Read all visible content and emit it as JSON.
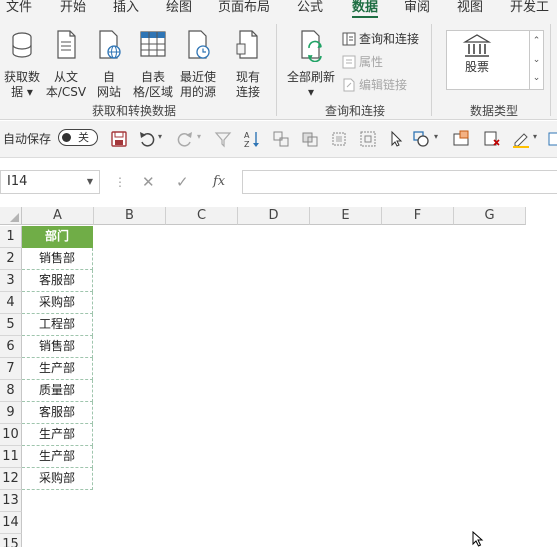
{
  "menu": {
    "tabs": [
      "文件",
      "开始",
      "插入",
      "绘图",
      "页面布局",
      "公式",
      "数据",
      "审阅",
      "视图",
      "开发工"
    ],
    "active": "数据"
  },
  "ribbon": {
    "get_transform": {
      "label": "获取和转换数据",
      "buttons": [
        {
          "line1": "获取数",
          "line2": "据 ▾"
        },
        {
          "line1": "从文",
          "line2": "本/CSV"
        },
        {
          "line1": "自",
          "line2": "网站"
        },
        {
          "line1": "自表",
          "line2": "格/区域"
        },
        {
          "line1": "最近使",
          "line2": "用的源"
        },
        {
          "line1": "现有",
          "line2": "连接"
        }
      ]
    },
    "queries": {
      "label": "查询和连接",
      "refresh_line1": "全部刷新",
      "refresh_line2": "▾",
      "items": [
        "查询和连接",
        "属性",
        "编辑链接"
      ]
    },
    "data_types": {
      "label": "数据类型",
      "gallery_item": "股票"
    }
  },
  "qat": {
    "autosave_label": "自动保存",
    "toggle_state": "关"
  },
  "formula_bar": {
    "name_box": "I14",
    "dots": "⋮",
    "cancel": "✕",
    "enter": "✓",
    "fx": "fx",
    "value": ""
  },
  "sheet": {
    "columns": [
      "A",
      "B",
      "C",
      "D",
      "E",
      "F",
      "G"
    ],
    "rows": [
      "1",
      "2",
      "3",
      "4",
      "5",
      "6",
      "7",
      "8",
      "9",
      "10",
      "11",
      "12",
      "13",
      "14",
      "15"
    ],
    "column_a": [
      "部门",
      "销售部",
      "客服部",
      "采购部",
      "工程部",
      "销售部",
      "生产部",
      "质量部",
      "客服部",
      "生产部",
      "生产部",
      "采购部"
    ]
  },
  "colors": {
    "accent": "#1f6e43",
    "header_fill": "#70ad47",
    "header_text": "#ffffff"
  }
}
